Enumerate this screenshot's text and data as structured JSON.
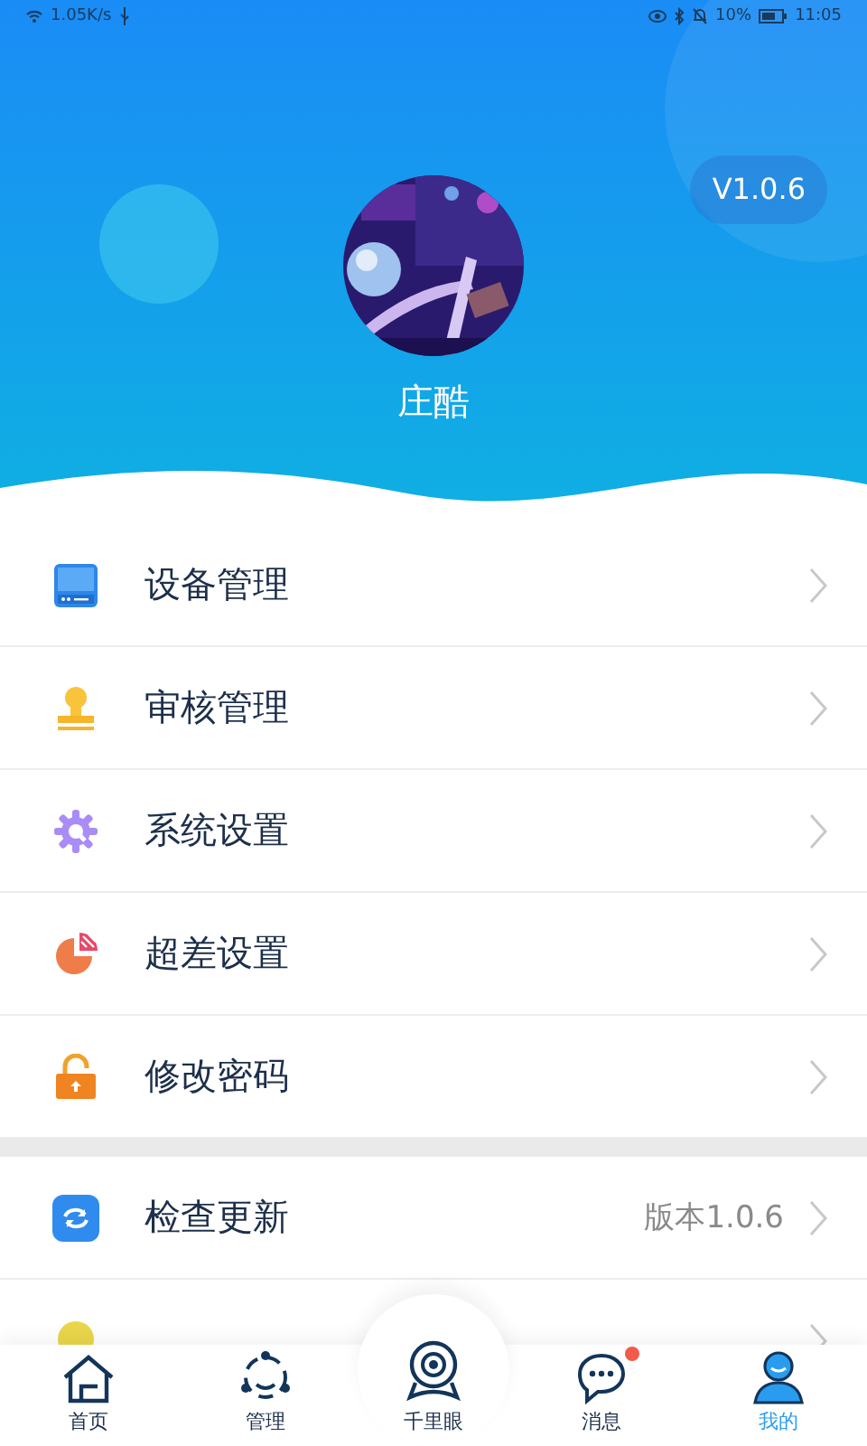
{
  "status_bar": {
    "speed": "1.05K/s",
    "battery": "10%",
    "time": "11:05"
  },
  "profile": {
    "version": "V1.0.6",
    "name": "庄酷"
  },
  "menu_groups": [
    {
      "items": [
        {
          "kind": "monitor",
          "label": "设备管理"
        },
        {
          "kind": "stamp",
          "label": "审核管理"
        },
        {
          "kind": "gear",
          "label": "系统设置"
        },
        {
          "kind": "pie",
          "label": "超差设置"
        },
        {
          "kind": "lock",
          "label": "修改密码"
        }
      ]
    },
    {
      "items": [
        {
          "kind": "refresh",
          "label": "检查更新",
          "value": "版本1.0.6"
        },
        {
          "kind": "bulb"
        }
      ]
    }
  ],
  "tab_bar": [
    {
      "kind": "home",
      "label": "首页",
      "selected": false,
      "badge": false
    },
    {
      "kind": "nodes",
      "label": "管理",
      "selected": false,
      "badge": false
    },
    {
      "kind": "camera",
      "label": "千里眼",
      "selected": false,
      "badge": false
    },
    {
      "kind": "chat",
      "label": "消息",
      "selected": false,
      "badge": true
    },
    {
      "kind": "user",
      "label": "我的",
      "selected": true,
      "badge": false
    }
  ]
}
